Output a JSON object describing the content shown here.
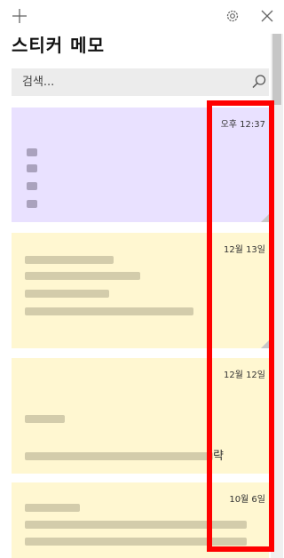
{
  "header": {
    "add_icon": "plus-icon",
    "settings_icon": "gear-icon",
    "close_icon": "close-icon"
  },
  "app": {
    "title": "스티커 메모"
  },
  "search": {
    "placeholder": "검색...",
    "icon": "search-icon"
  },
  "notes": [
    {
      "date": "오후 12:37",
      "color": "#e9e1ff"
    },
    {
      "date": "12월 13일",
      "color": "#fff7d1"
    },
    {
      "date": "12월 12일",
      "color": "#fff7d1",
      "visible_text_tail": "략"
    },
    {
      "date": "10월 6일",
      "color": "#fff7d1"
    }
  ],
  "highlight": {
    "color": "#ff0000"
  }
}
